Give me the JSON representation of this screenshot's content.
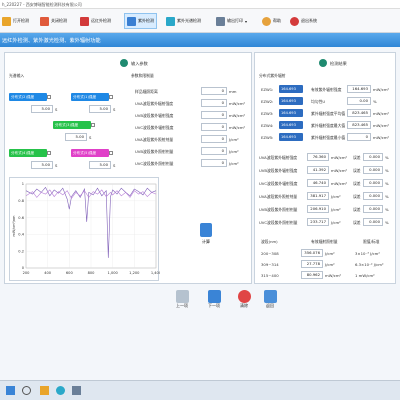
{
  "window": {
    "title": "h_220227 - 西安博瑞智能检测科技有限公司"
  },
  "toolbar": {
    "items": [
      {
        "label": "打开检测",
        "color": "#e9a52b"
      },
      {
        "label": "关闭检测",
        "color": "#e05a3b"
      },
      {
        "label": "远红外检测",
        "color": "#d23a3a"
      },
      {
        "label": "紫外检测",
        "color": "#3a7fd2"
      },
      {
        "label": "紫外光谱检测",
        "color": "#2aa8c9"
      },
      {
        "label": "输出打印",
        "color": "#6a7f98"
      },
      {
        "label": "帮助",
        "color": "#e6a23c"
      },
      {
        "label": "退出系统",
        "color": "#d43b3b"
      }
    ]
  },
  "breadcrumb": "远红外检测、紫外激光检测、紫外辐射功能",
  "left_panel": {
    "section_title": "输入参数",
    "group_label": "光谱输入",
    "params_label": "参数和限制量",
    "tags": [
      {
        "label": "分布式(2)强度",
        "value": "5.00",
        "unit": "S",
        "color": "#1e88e5"
      },
      {
        "label": "分布式(1)强度",
        "value": "5.00",
        "unit": "S",
        "color": "#1e88e5"
      },
      {
        "label": "分布式(3)强度",
        "value": "5.00",
        "unit": "S",
        "color": "#26c24a"
      },
      {
        "label": "分布式(4)强度",
        "value": "5.00",
        "unit": "S",
        "color": "#26c24a"
      },
      {
        "label": "分布式(5)强度",
        "value": "5.00",
        "unit": "S",
        "color": "#e040c8"
      }
    ],
    "param_rows": [
      {
        "label": "样品辐照距离",
        "value": "0",
        "unit": "mm"
      },
      {
        "label": "UVA波段紫外辐射强度",
        "value": "0",
        "unit": "mW/cm²"
      },
      {
        "label": "UVB波段紫外辐射强度",
        "value": "0",
        "unit": "mW/cm²"
      },
      {
        "label": "UVC波段紫外辐射强度",
        "value": "0",
        "unit": "mW/cm²"
      },
      {
        "label": "UVA波段紫外照射剂量",
        "value": "0",
        "unit": "J/cm²"
      },
      {
        "label": "UVB波段紫外照射剂量",
        "value": "0",
        "unit": "J/cm²"
      },
      {
        "label": "UVC波段紫外照射剂量",
        "value": "0",
        "unit": "J/cm²"
      }
    ],
    "calc_button": "计算"
  },
  "chart_data": {
    "type": "line",
    "xlabel": "",
    "ylabel": "mW/cm²/nm",
    "xlim": [
      200,
      1400
    ],
    "x_ticks": [
      "200",
      "400",
      "600",
      "800",
      "1,000",
      "1,200",
      "1,400"
    ],
    "ylim": [
      0,
      1
    ],
    "y_ticks": [
      "1",
      "0.8",
      "0.6",
      "0.4",
      "0.2",
      "0"
    ],
    "series": [
      {
        "color": "#7f5fb8",
        "x": [
          200,
          260,
          300,
          340,
          380,
          420,
          460,
          500,
          540,
          580,
          600,
          620,
          660,
          700,
          740,
          760,
          780,
          820,
          860,
          900,
          940,
          960,
          980,
          1000,
          1040,
          1080,
          1120,
          1160,
          1200,
          1240,
          1280,
          1320,
          1360,
          1400
        ],
        "y": [
          0.92,
          0.88,
          0.94,
          0.9,
          0.96,
          0.86,
          0.93,
          0.89,
          0.95,
          0.82,
          0.7,
          0.85,
          0.92,
          0.84,
          0.94,
          0.55,
          0.9,
          0.87,
          0.95,
          0.86,
          0.92,
          0.12,
          0.85,
          0.93,
          0.88,
          0.95,
          0.9,
          0.86,
          0.94,
          0.91,
          0.87,
          0.95,
          0.9,
          0.92
        ]
      },
      {
        "color": "#b77fd8",
        "x": [
          200,
          260,
          300,
          340,
          380,
          420,
          460,
          500,
          540,
          580,
          620,
          660,
          700,
          740,
          780,
          820,
          860,
          900,
          940,
          980,
          1000,
          1040,
          1080,
          1120,
          1160,
          1200,
          1240,
          1280,
          1320,
          1360,
          1400
        ],
        "y": [
          0.86,
          0.91,
          0.84,
          0.9,
          0.88,
          0.93,
          0.85,
          0.91,
          0.87,
          0.92,
          0.83,
          0.9,
          0.86,
          0.92,
          0.84,
          0.91,
          0.88,
          0.93,
          0.85,
          0.9,
          0.87,
          0.92,
          0.86,
          0.9,
          0.84,
          0.92,
          0.88,
          0.91,
          0.85,
          0.9,
          0.88
        ]
      }
    ]
  },
  "right_panel": {
    "section_title": "检测结果",
    "group_label": "分布式紫外辐射",
    "ezw": [
      {
        "label": "EZW1:",
        "value": "164.693"
      },
      {
        "label": "EZW2:",
        "value": "164.693"
      },
      {
        "label": "EZW3:",
        "value": "164.693"
      },
      {
        "label": "EZW4:",
        "value": "164.693"
      },
      {
        "label": "EZW5:",
        "value": "164.693"
      }
    ],
    "summary": [
      {
        "label": "有效紫外辐射强度",
        "value": "164.693",
        "unit": "mW/cm²"
      },
      {
        "label": "均匀性U",
        "value": "0.00",
        "unit": "%"
      },
      {
        "label": "紫外辐射强度平均值",
        "value": "823.465",
        "unit": "mW/cm²"
      },
      {
        "label": "紫外辐射强度最大值",
        "value": "823.465",
        "unit": "mW/cm²"
      },
      {
        "label": "紫外辐射强度最小值",
        "value": "0",
        "unit": "mW/cm²"
      }
    ],
    "uv_rows": [
      {
        "label": "UVA波段紫外辐射强度",
        "value": "76.360",
        "unit": "mW/cm²",
        "k": "误差",
        "kv": "0.000",
        "ku": "%"
      },
      {
        "label": "UVB波段紫外辐射强度",
        "value": "41.392",
        "unit": "mW/cm²",
        "k": "误差",
        "kv": "0.000",
        "ku": "%"
      },
      {
        "label": "UVC波段紫外辐射强度",
        "value": "46.740",
        "unit": "mW/cm²",
        "k": "误差",
        "kv": "0.000",
        "ku": "%"
      },
      {
        "label": "UVA波段紫外照射剂量",
        "value": "381.917",
        "unit": "J/cm²",
        "k": "误差",
        "kv": "0.000",
        "ku": "%"
      },
      {
        "label": "UVB波段紫外照射剂量",
        "value": "206.910",
        "unit": "J/cm²",
        "k": "误差",
        "kv": "0.000",
        "ku": "%"
      },
      {
        "label": "UVC波段紫外照射剂量",
        "value": "233.717",
        "unit": "J/cm²",
        "k": "误差",
        "kv": "0.000",
        "ku": "%"
      }
    ],
    "band_headers": [
      "波段(nm)",
      "有效辐射照射量",
      "限值/标准"
    ],
    "bands": [
      {
        "band": "200~308",
        "value": "356.076",
        "unit": "J/cm²",
        "limit": "3×10⁻³ J/cm²"
      },
      {
        "band": "309~314",
        "value": "27.778",
        "unit": "J/cm²",
        "limit": "6.3×10⁻² J/cm²"
      },
      {
        "band": "315~400",
        "value": "80.962",
        "unit": "mW/cm²",
        "limit": "1 mW/cm²"
      }
    ]
  },
  "bottom_buttons": [
    {
      "label": "上一项",
      "color": "#b5c2cf"
    },
    {
      "label": "下一项",
      "color": "#3a84d6"
    },
    {
      "label": "清除",
      "color": "#e04545"
    },
    {
      "label": "返回",
      "color": "#4a8fd9"
    }
  ]
}
